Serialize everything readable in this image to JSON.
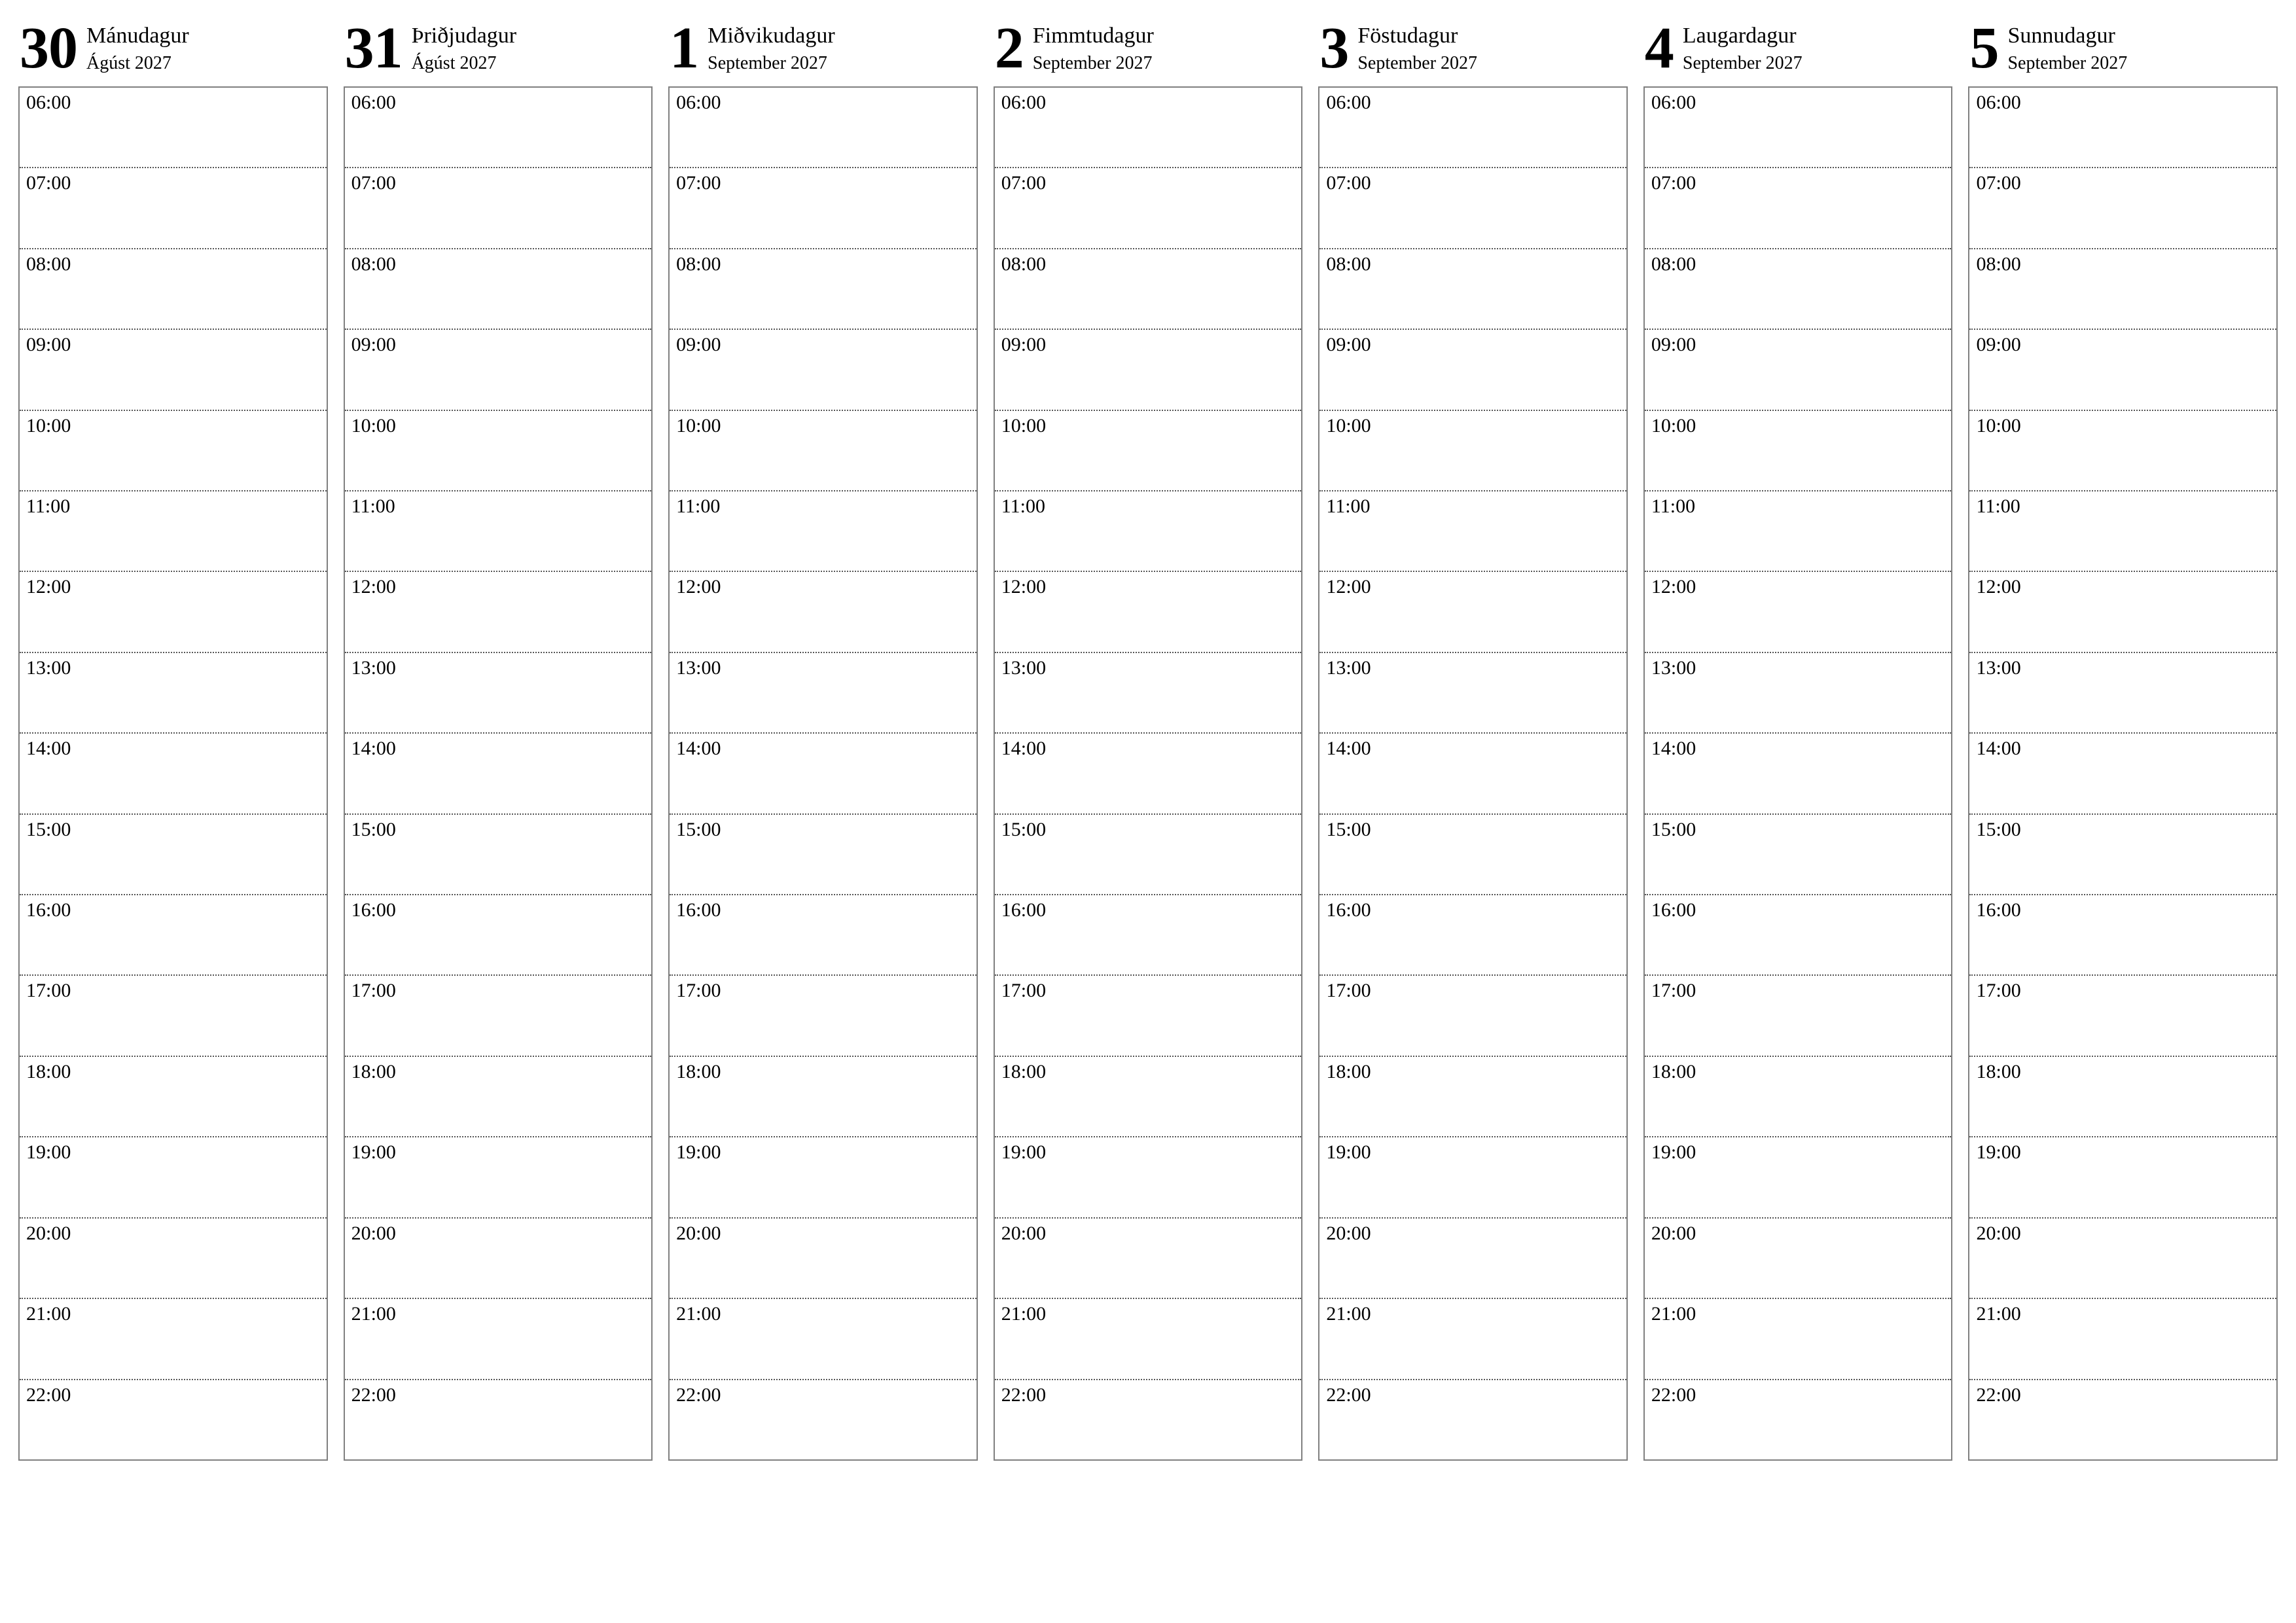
{
  "hours": [
    "06:00",
    "07:00",
    "08:00",
    "09:00",
    "10:00",
    "11:00",
    "12:00",
    "13:00",
    "14:00",
    "15:00",
    "16:00",
    "17:00",
    "18:00",
    "19:00",
    "20:00",
    "21:00",
    "22:00"
  ],
  "days": [
    {
      "num": "30",
      "name": "Mánudagur",
      "sub": "Ágúst 2027"
    },
    {
      "num": "31",
      "name": "Þriðjudagur",
      "sub": "Ágúst 2027"
    },
    {
      "num": "1",
      "name": "Miðvikudagur",
      "sub": "September 2027"
    },
    {
      "num": "2",
      "name": "Fimmtudagur",
      "sub": "September 2027"
    },
    {
      "num": "3",
      "name": "Föstudagur",
      "sub": "September 2027"
    },
    {
      "num": "4",
      "name": "Laugardagur",
      "sub": "September 2027"
    },
    {
      "num": "5",
      "name": "Sunnudagur",
      "sub": "September 2027"
    }
  ]
}
